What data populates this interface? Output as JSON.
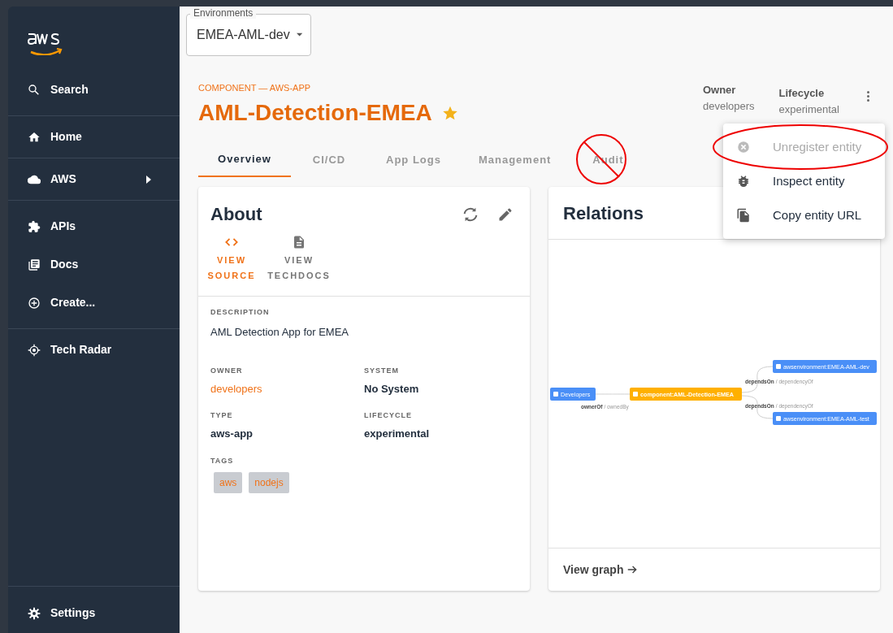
{
  "sidebar": {
    "groups": [
      [
        {
          "label": "Search",
          "expandable": false
        }
      ],
      [
        {
          "label": "Home",
          "expandable": false
        }
      ],
      [
        {
          "label": "AWS",
          "expandable": true
        }
      ],
      [
        {
          "label": "APIs",
          "expandable": false
        },
        {
          "label": "Docs",
          "expandable": false
        },
        {
          "label": "Create...",
          "expandable": false
        }
      ],
      [
        {
          "label": "Tech Radar",
          "expandable": false
        }
      ]
    ],
    "footer_item": {
      "label": "Settings"
    }
  },
  "environment_select": {
    "label": "Environments",
    "value": "EMEA-AML-dev"
  },
  "header": {
    "type_label": "COMPONENT — AWS-APP",
    "title": "AML-Detection-EMEA",
    "starred": true,
    "meta": [
      {
        "label": "Owner",
        "value": "developers"
      },
      {
        "label": "Lifecycle",
        "value": "experimental"
      }
    ]
  },
  "tabs": [
    {
      "label": "Overview",
      "selected": true,
      "annotated": false
    },
    {
      "label": "CI/CD",
      "selected": false,
      "annotated": false
    },
    {
      "label": "App Logs",
      "selected": false,
      "annotated": false
    },
    {
      "label": "Management",
      "selected": false,
      "annotated": false
    },
    {
      "label": "Audit",
      "selected": false,
      "annotated": true
    }
  ],
  "menu": {
    "items": [
      {
        "label": "Unregister entity",
        "disabled": true,
        "annotated": true
      },
      {
        "label": "Inspect entity",
        "disabled": false,
        "annotated": false
      },
      {
        "label": "Copy entity URL",
        "disabled": false,
        "annotated": false
      }
    ]
  },
  "about": {
    "title": "About",
    "links": [
      {
        "label": "VIEW SOURCE",
        "disabled": false
      },
      {
        "label": "VIEW TECHDOCS",
        "disabled": true
      }
    ],
    "description": {
      "label": "DESCRIPTION",
      "value": "AML Detection App for EMEA"
    },
    "fields": [
      {
        "label": "OWNER",
        "value": "developers",
        "kind": "link"
      },
      {
        "label": "SYSTEM",
        "value": "No System",
        "kind": "text"
      },
      {
        "label": "TYPE",
        "value": "aws-app",
        "kind": "text"
      },
      {
        "label": "LIFECYCLE",
        "value": "experimental",
        "kind": "text"
      }
    ],
    "tags": {
      "label": "TAGS",
      "items": [
        "aws",
        "nodejs"
      ]
    }
  },
  "relations": {
    "title": "Relations",
    "link": "View graph",
    "nodes": [
      {
        "label": "Developers",
        "color": "#4a8ff7"
      },
      {
        "label": "component:AML-Detection-EMEA",
        "color": "#ffb000"
      },
      {
        "label": "awsenvironment:EMEA-AML-dev",
        "color": "#4a8ff7"
      },
      {
        "label": "awsenvironment:EMEA-AML-test",
        "color": "#4a8ff7"
      }
    ],
    "edges": [
      {
        "label": "ownerOf",
        "reverse_label": "/ ownedBy"
      },
      {
        "label": "dependsOn",
        "reverse_label": "/ dependencyOf"
      },
      {
        "label": "dependsOn",
        "reverse_label": "/ dependencyOf"
      }
    ]
  }
}
